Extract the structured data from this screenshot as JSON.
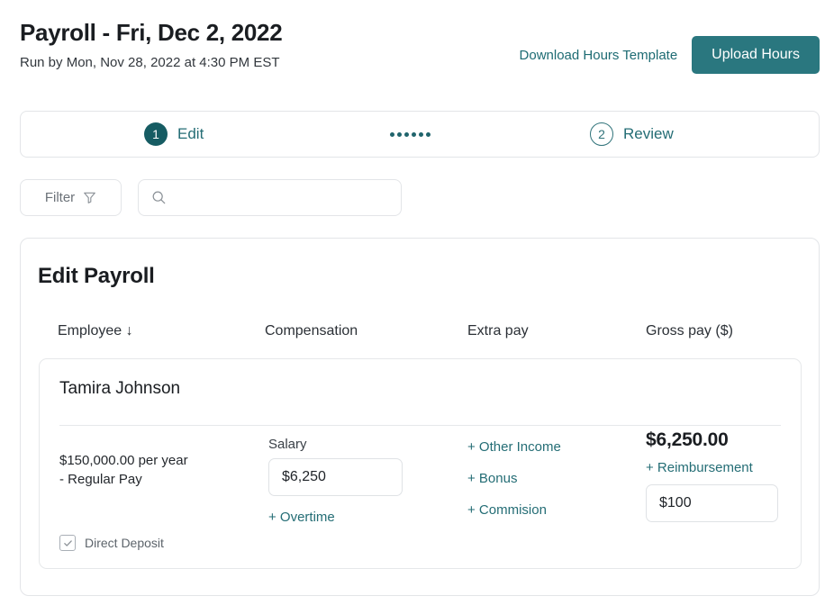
{
  "header": {
    "title": "Payroll - Fri, Dec 2, 2022",
    "subtitle": "Run by Mon, Nov 28, 2022 at 4:30 PM EST",
    "download_label": "Download Hours Template",
    "upload_label": "Upload Hours"
  },
  "stepper": {
    "steps": [
      {
        "number": "1",
        "label": "Edit",
        "state": "active"
      },
      {
        "number": "2",
        "label": "Review",
        "state": "inactive"
      }
    ],
    "dot_count": 6
  },
  "toolbar": {
    "filter_label": "Filter",
    "filter_icon": "funnel-icon",
    "search_icon": "search-icon",
    "search_value": "",
    "search_placeholder": ""
  },
  "panel": {
    "title": "Edit Payroll",
    "columns": [
      "Employee ↓",
      "Compensation",
      "Extra pay",
      "Gross pay ($)"
    ],
    "employees": [
      {
        "name": "Tamira Johnson",
        "compensation_rate": "$150,000.00 per year",
        "compensation_type": "- Regular Pay",
        "direct_deposit_label": "Direct Deposit",
        "direct_deposit_checked": true,
        "salary_label": "Salary",
        "salary_value": "$6,250",
        "overtime_link": "+ Overtime",
        "extra_pay_links": [
          "+ Other Income",
          "+ Bonus",
          "+ Commision"
        ],
        "gross_pay": "$6,250.00",
        "reimbursement_link": "+ Reimbursement",
        "reimbursement_value": "$100"
      }
    ]
  },
  "colors": {
    "accent_teal": "#2a777f",
    "link_teal": "#246d75",
    "step_active": "#165c63",
    "border": "#e3e5e8",
    "text": "#1a1d21"
  }
}
